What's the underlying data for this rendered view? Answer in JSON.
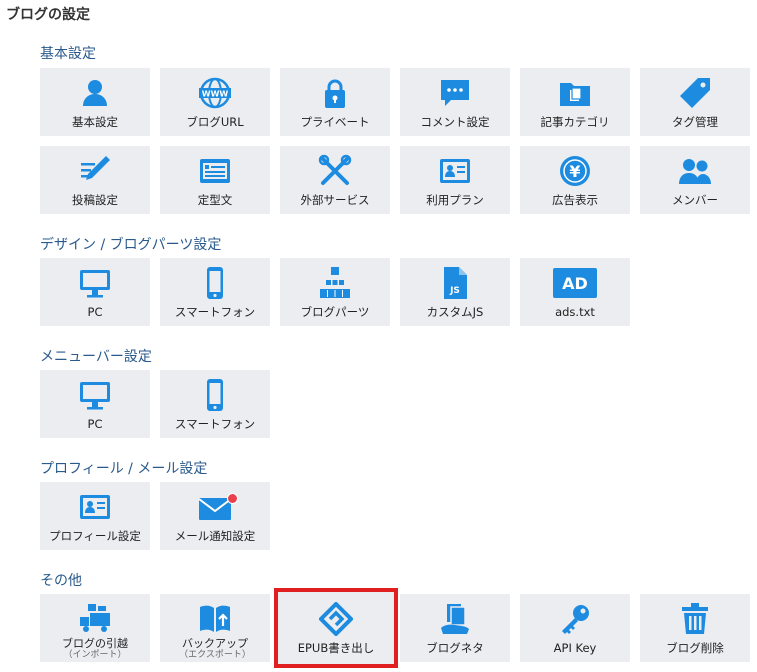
{
  "page_title": "ブログの設定",
  "colors": {
    "icon": "#1c8be0",
    "tile_bg": "#ebedf0",
    "section": "#2a5a8c",
    "highlight": "#e02020",
    "badge": "#e9414c"
  },
  "sections": {
    "basic": {
      "title": "基本設定",
      "tiles": [
        {
          "label": "基本設定",
          "icon": "person-icon"
        },
        {
          "label": "ブログURL",
          "icon": "www-globe-icon"
        },
        {
          "label": "プライベート",
          "icon": "lock-icon"
        },
        {
          "label": "コメント設定",
          "icon": "speech-bubble-icon"
        },
        {
          "label": "記事カテゴリ",
          "icon": "folder-icon"
        },
        {
          "label": "タグ管理",
          "icon": "tag-icon"
        },
        {
          "label": "投稿設定",
          "icon": "pencil-icon"
        },
        {
          "label": "定型文",
          "icon": "template-icon"
        },
        {
          "label": "外部サービス",
          "icon": "tools-cross-icon"
        },
        {
          "label": "利用プラン",
          "icon": "id-card-icon"
        },
        {
          "label": "広告表示",
          "icon": "yen-coin-icon"
        },
        {
          "label": "メンバー",
          "icon": "members-icon"
        }
      ]
    },
    "design": {
      "title": "デザイン / ブログパーツ設定",
      "tiles": [
        {
          "label": "PC",
          "icon": "monitor-icon"
        },
        {
          "label": "スマートフォン",
          "icon": "smartphone-icon"
        },
        {
          "label": "ブログパーツ",
          "icon": "blog-parts-icon"
        },
        {
          "label": "カスタムJS",
          "icon": "js-file-icon"
        },
        {
          "label": "ads.txt",
          "icon": "ad-icon",
          "icon_text": "AD"
        }
      ]
    },
    "menubar": {
      "title": "メニューバー設定",
      "tiles": [
        {
          "label": "PC",
          "icon": "monitor-icon"
        },
        {
          "label": "スマートフォン",
          "icon": "smartphone-icon"
        }
      ]
    },
    "profile": {
      "title": "プロフィール / メール設定",
      "tiles": [
        {
          "label": "プロフィール設定",
          "icon": "profile-card-icon"
        },
        {
          "label": "メール通知設定",
          "icon": "mail-icon"
        }
      ]
    },
    "other": {
      "title": "その他",
      "tiles": [
        {
          "label": "ブログの引越",
          "sub": "（インポート）",
          "icon": "moving-truck-icon"
        },
        {
          "label": "バックアップ",
          "sub": "（エクスポート）",
          "icon": "backup-book-icon"
        },
        {
          "label": "EPUB書き出し",
          "icon": "epub-icon",
          "selected": true
        },
        {
          "label": "ブログネタ",
          "icon": "blog-neta-icon"
        },
        {
          "label": "API Key",
          "icon": "key-icon"
        },
        {
          "label": "ブログ削除",
          "icon": "trash-icon"
        }
      ]
    }
  }
}
